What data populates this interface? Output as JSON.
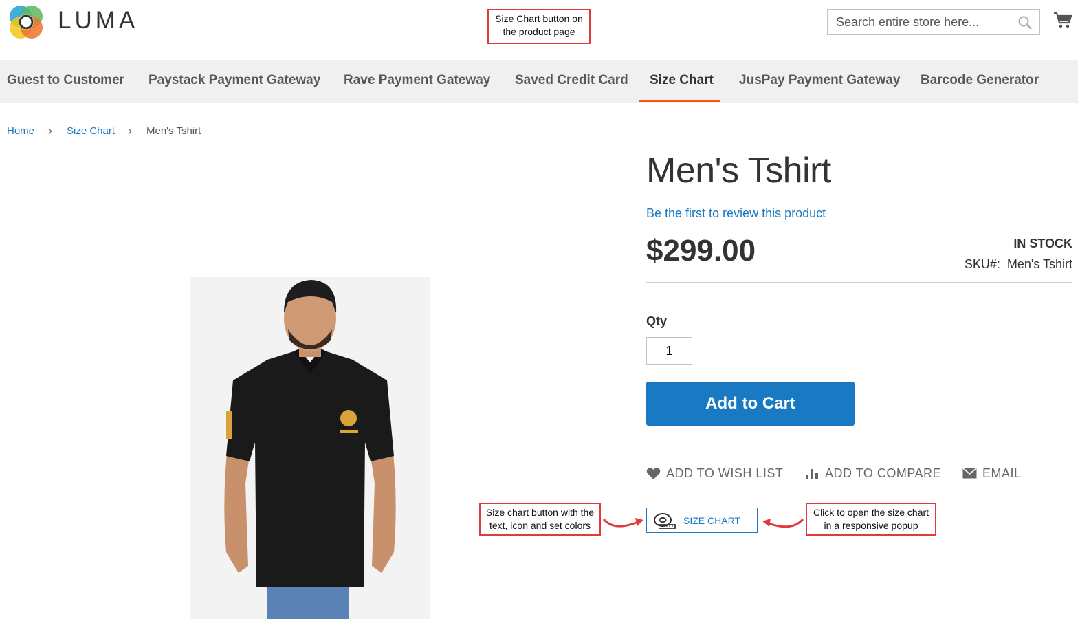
{
  "header": {
    "logo_text": "LUMA",
    "search_placeholder": "Search entire store here...",
    "colors": {
      "accent": "#1979c3",
      "nav_active": "#ff5501"
    }
  },
  "nav": {
    "items": [
      {
        "label": "Guest to Customer"
      },
      {
        "label": "Paystack Payment Gateway"
      },
      {
        "label": "Rave Payment Gateway"
      },
      {
        "label": "Saved Credit Card"
      },
      {
        "label": "Size Chart",
        "active": true
      },
      {
        "label": "JusPay Payment Gateway"
      },
      {
        "label": "Barcode Generator"
      }
    ]
  },
  "breadcrumb": {
    "home": "Home",
    "category": "Size Chart",
    "current": "Men's Tshirt"
  },
  "product": {
    "title": "Men's Tshirt",
    "review_link": "Be the first to review this product",
    "price": "$299.00",
    "stock": "IN STOCK",
    "sku_label": "SKU#:",
    "sku_value": "Men's Tshirt",
    "qty_label": "Qty",
    "qty_value": "1",
    "add_to_cart": "Add to Cart",
    "actions": {
      "wishlist": "ADD TO WISH LIST",
      "compare": "ADD TO COMPARE",
      "email": "EMAIL"
    },
    "size_chart_button": "SIZE CHART"
  },
  "annotations": {
    "top": "Size Chart button on the product page",
    "left": "Size chart button with the text, icon and set colors",
    "right": "Click to open the size chart in a responsive popup"
  }
}
